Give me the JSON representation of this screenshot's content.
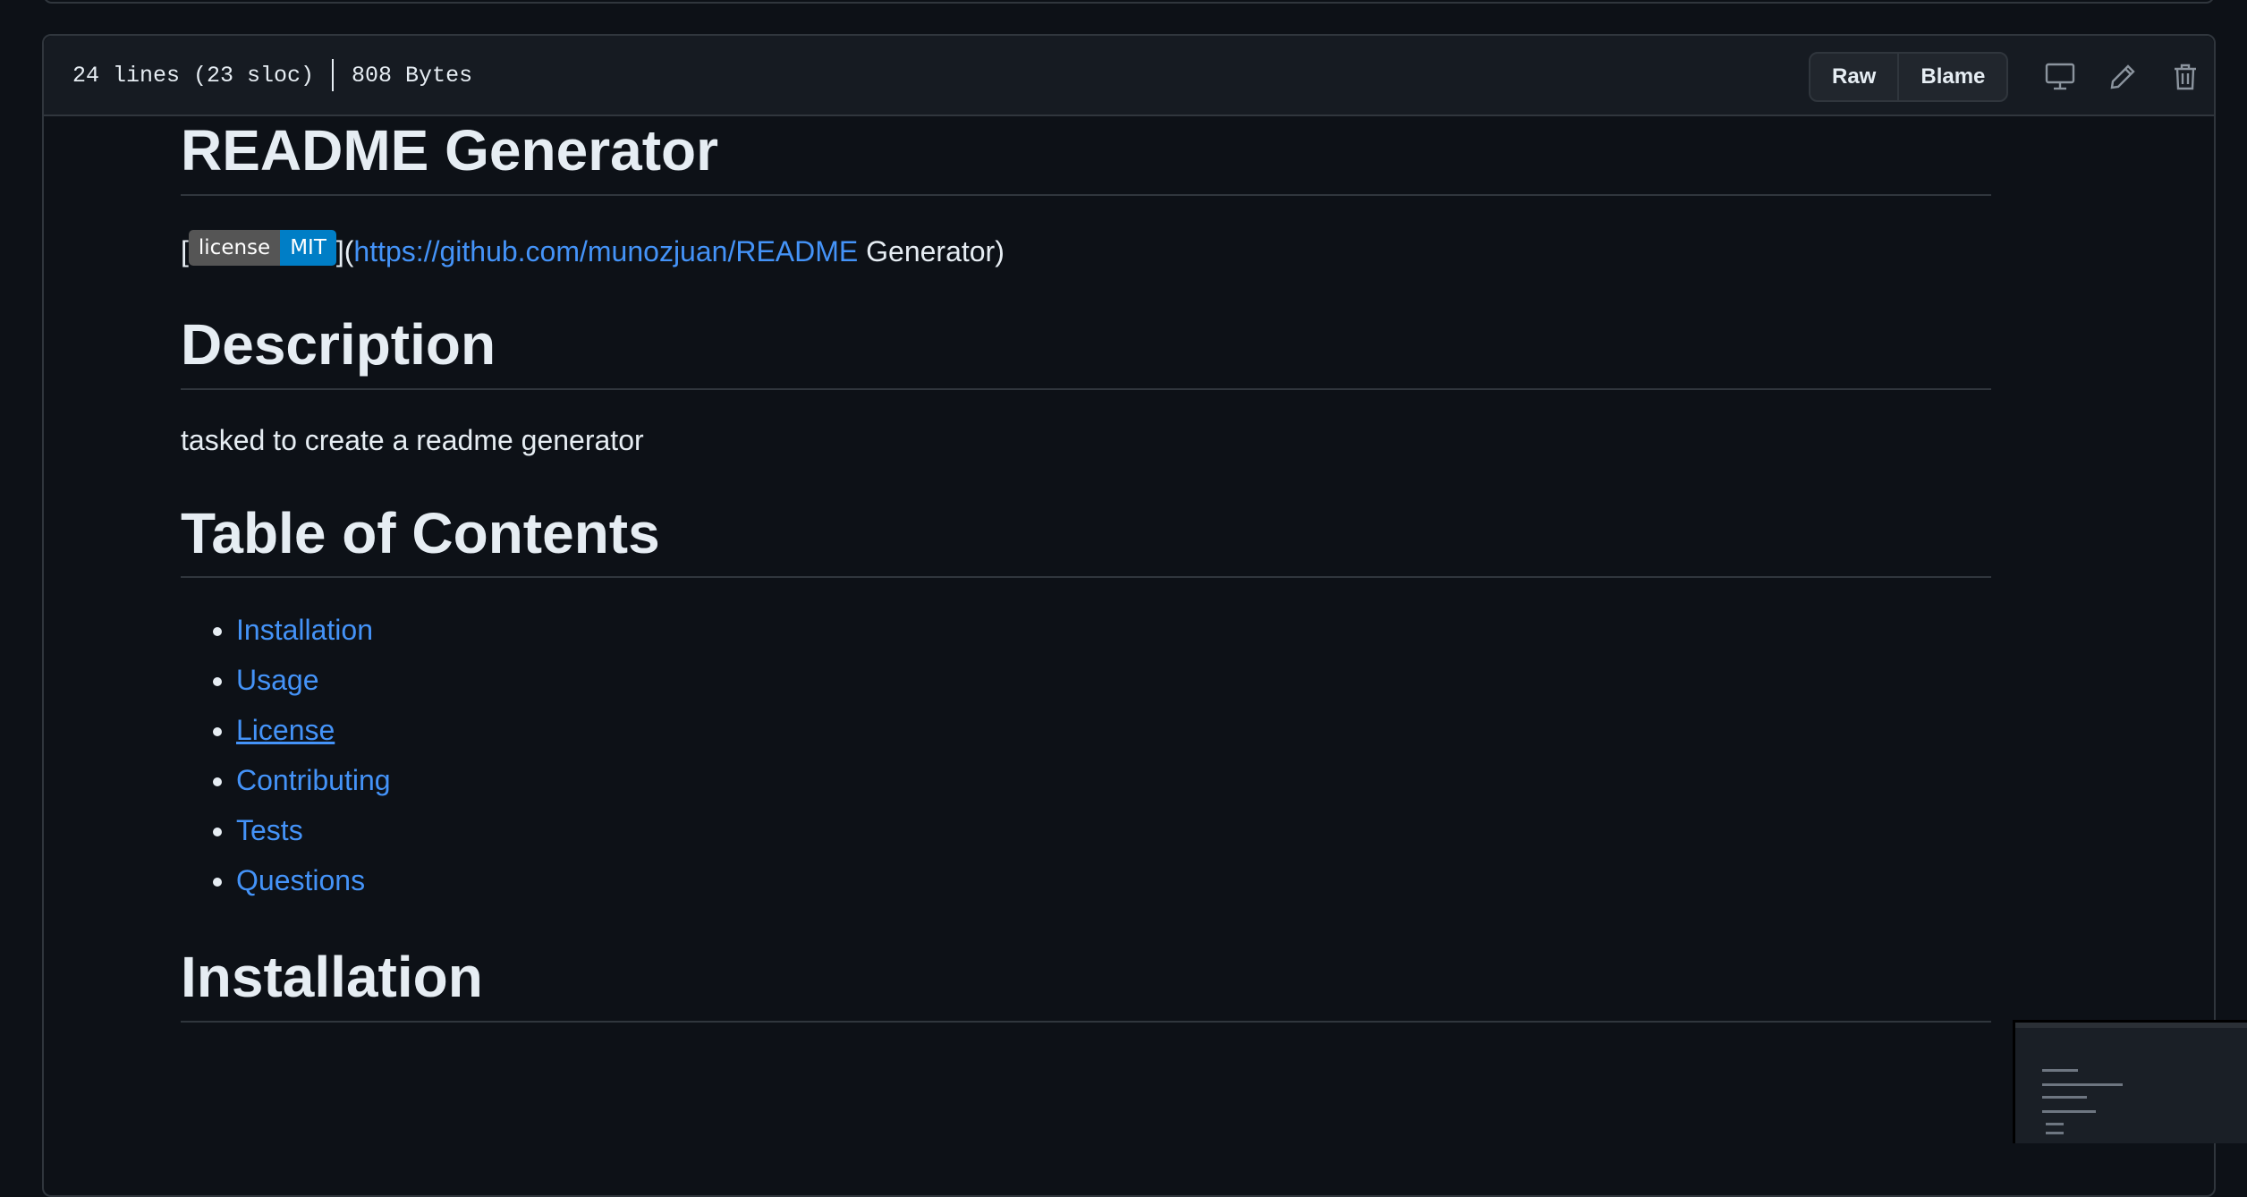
{
  "file_header": {
    "lines": "24 lines (23 sloc)",
    "size": "808 Bytes",
    "raw_label": "Raw",
    "blame_label": "Blame"
  },
  "icons": {
    "display": "desktop-icon",
    "edit": "pencil-icon",
    "delete": "trash-icon"
  },
  "readme": {
    "title": "README Generator",
    "badge": {
      "left_text": "license",
      "right_text": "MIT",
      "left_color": "#555555",
      "right_color": "#007ec6"
    },
    "badge_line": {
      "open_bracket": "[",
      "close_paren_open": "](",
      "link_text": "https://github.com/munozjuan/README",
      "tail_text": " Generator)"
    },
    "description_heading": "Description",
    "description_text": "tasked to create a readme generator",
    "toc_heading": "Table of Contents",
    "toc_items": [
      {
        "label": "Installation"
      },
      {
        "label": "Usage"
      },
      {
        "label": "License"
      },
      {
        "label": "Contributing"
      },
      {
        "label": "Tests"
      },
      {
        "label": "Questions"
      }
    ],
    "installation_heading": "Installation"
  },
  "colors": {
    "background": "#0d1117",
    "header_bg": "#161b22",
    "border": "#30363d",
    "link": "#4493f8",
    "text": "#e6edf3"
  }
}
